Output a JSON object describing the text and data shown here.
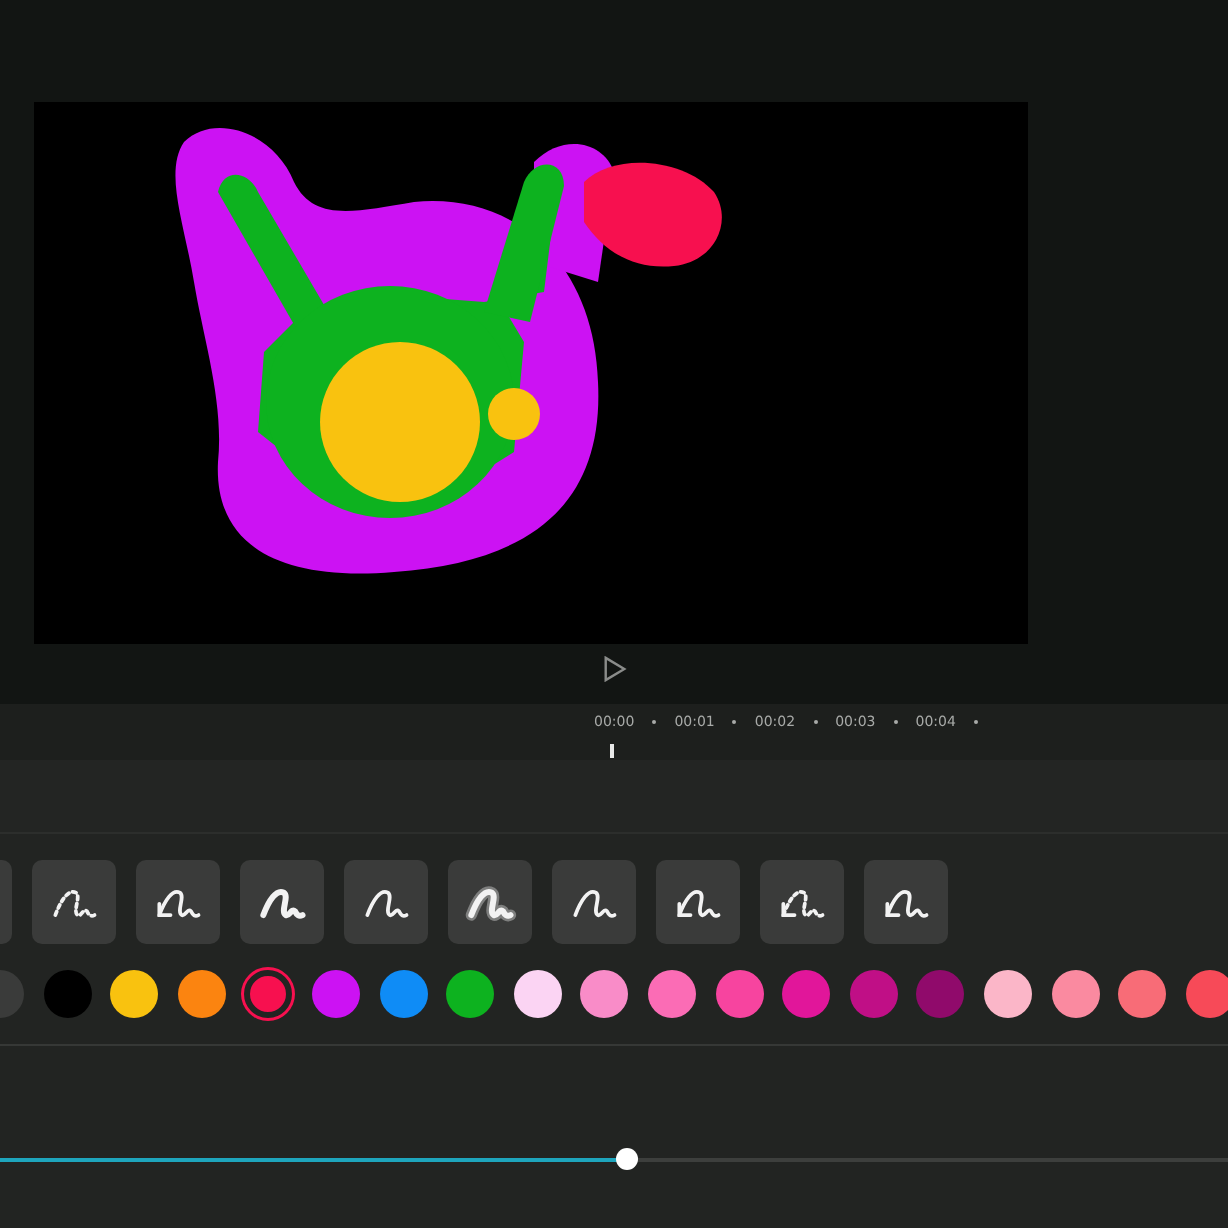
{
  "timeline": {
    "labels": [
      "00:00",
      "00:01",
      "00:02",
      "00:03",
      "00:04"
    ]
  },
  "brushes": [
    {
      "selected": false
    },
    {
      "kind": "dashed",
      "selected": false
    },
    {
      "kind": "arrow",
      "selected": false
    },
    {
      "kind": "rough",
      "selected": false
    },
    {
      "kind": "plain",
      "selected": false
    },
    {
      "kind": "glow",
      "selected": false
    },
    {
      "kind": "plain",
      "selected": false
    },
    {
      "kind": "arrow",
      "selected": false
    },
    {
      "kind": "dashed-arrow",
      "selected": false
    },
    {
      "kind": "arrow",
      "selected": false
    }
  ],
  "colors": [
    {
      "color": "#3a3b3a",
      "selected": false
    },
    {
      "color": "#000000",
      "selected": false
    },
    {
      "color": "#f9c20f",
      "selected": false
    },
    {
      "color": "#fb8410",
      "selected": false
    },
    {
      "color": "#f7104f",
      "selected": true
    },
    {
      "color": "#cc12f3",
      "selected": false
    },
    {
      "color": "#0f8cf6",
      "selected": false
    },
    {
      "color": "#0db21f",
      "selected": false
    },
    {
      "color": "#fbd4f3",
      "selected": false
    },
    {
      "color": "#f98cc8",
      "selected": false
    },
    {
      "color": "#fb6cb5",
      "selected": false
    },
    {
      "color": "#f7449f",
      "selected": false
    },
    {
      "color": "#e1169a",
      "selected": false
    },
    {
      "color": "#c00f86",
      "selected": false
    },
    {
      "color": "#900a6b",
      "selected": false
    },
    {
      "color": "#fbb6c8",
      "selected": false
    },
    {
      "color": "#fa8aa0",
      "selected": false
    },
    {
      "color": "#f86c77",
      "selected": false
    },
    {
      "color": "#f74a58",
      "selected": false
    }
  ],
  "size_slider": {
    "level": 0.51
  }
}
